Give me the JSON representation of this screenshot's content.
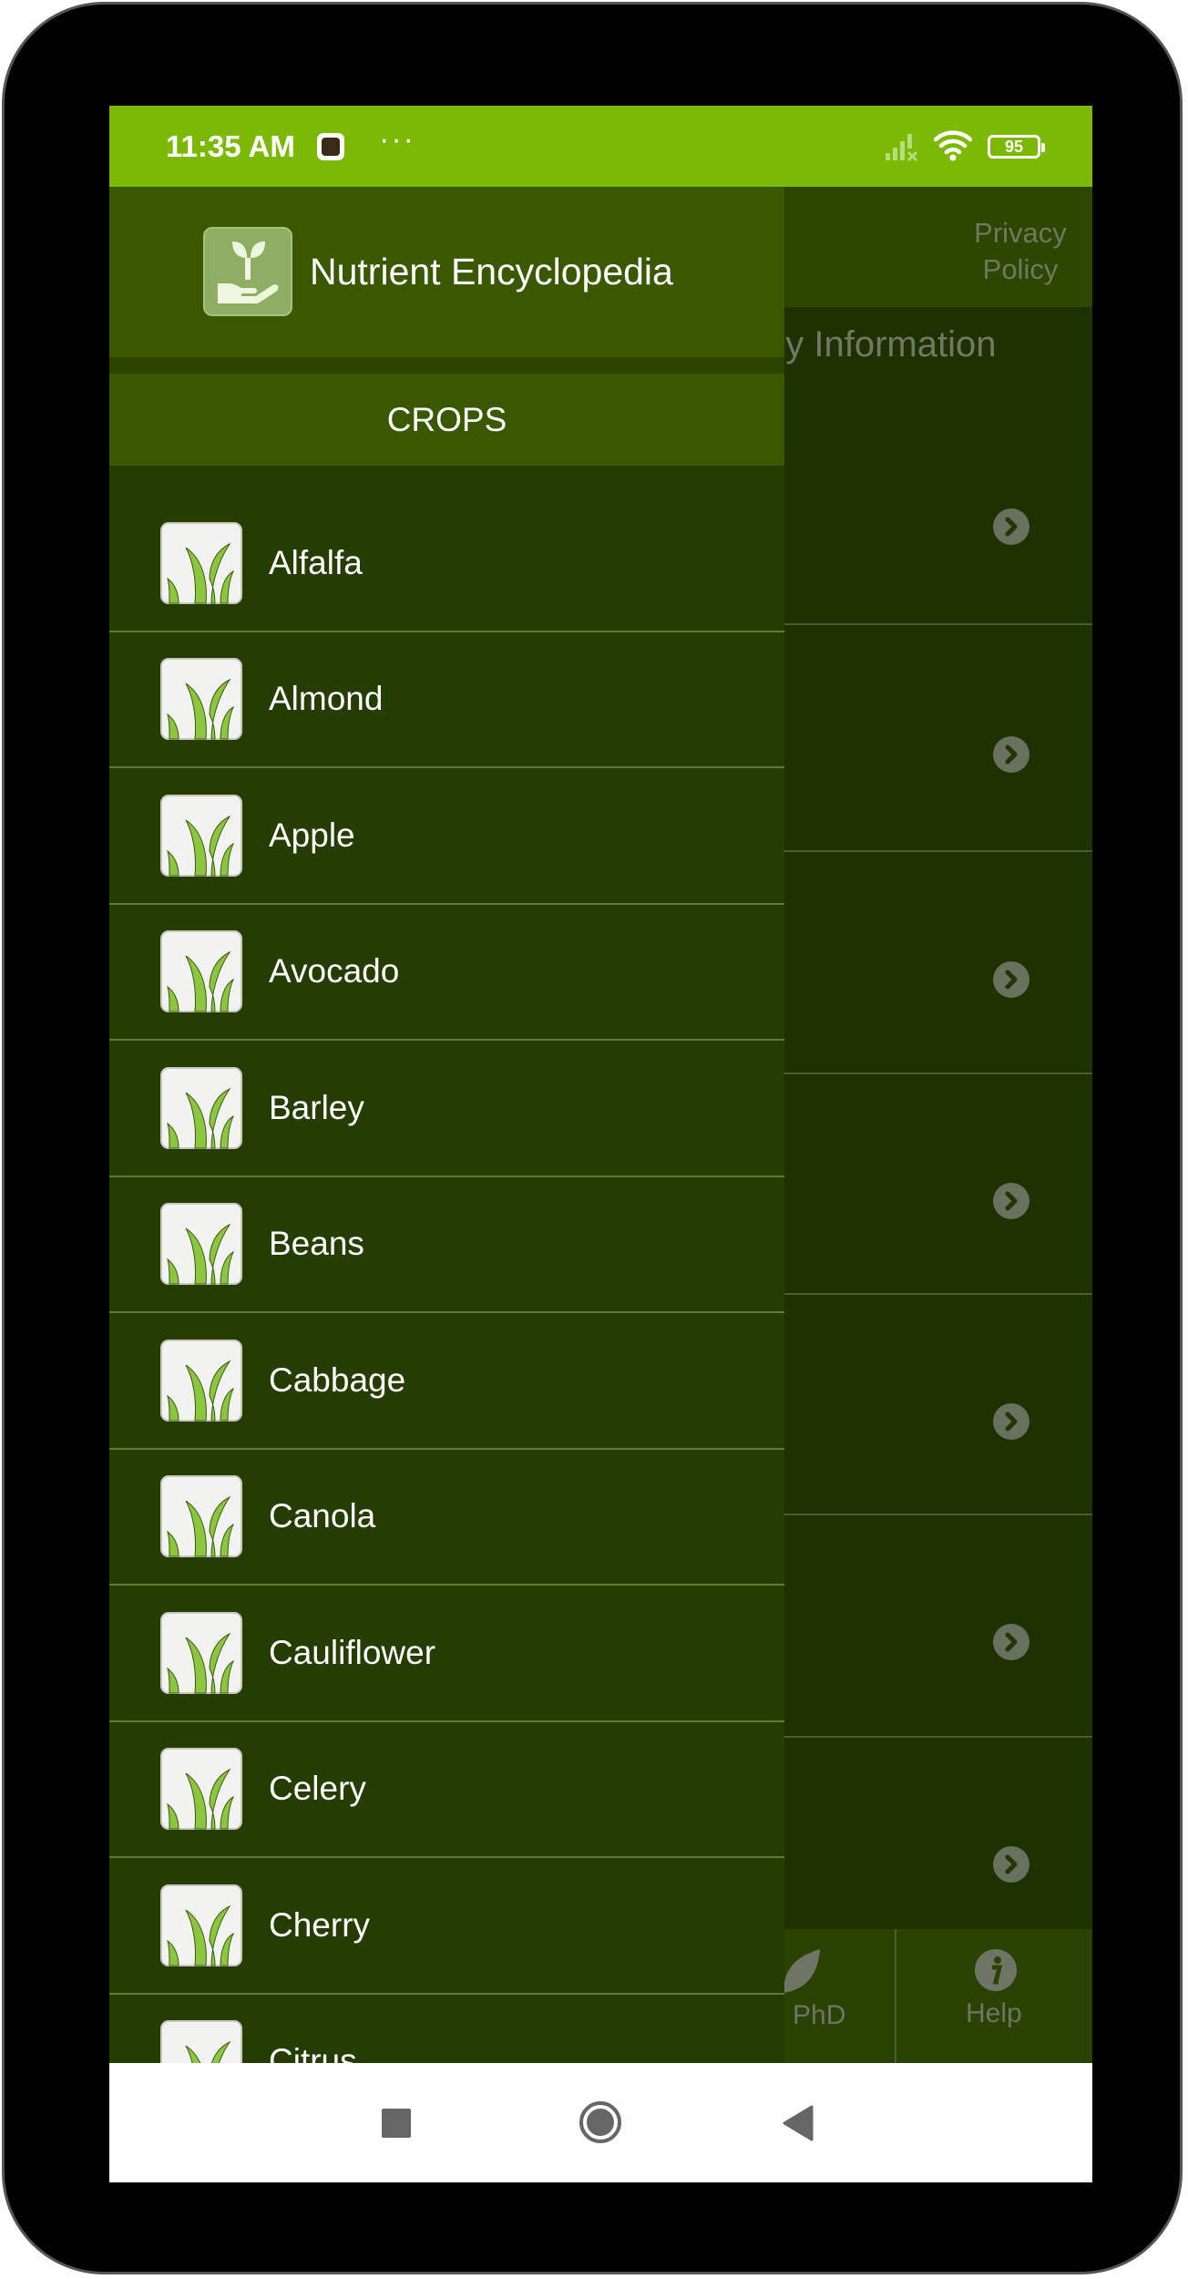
{
  "status_bar": {
    "time": "11:35 AM",
    "more": "···",
    "battery": "95"
  },
  "background": {
    "privacy_policy": "Privacy Policy",
    "section_title": "ncy Information",
    "tabs": [
      {
        "label": "PhD",
        "icon": "leaf-icon"
      },
      {
        "label": "Help",
        "icon": "info-icon"
      }
    ]
  },
  "drawer": {
    "app_title": "Nutrient Encyclopedia",
    "section": "CROPS",
    "items": [
      {
        "label": "Alfalfa"
      },
      {
        "label": "Almond"
      },
      {
        "label": "Apple"
      },
      {
        "label": "Avocado"
      },
      {
        "label": "Barley"
      },
      {
        "label": "Beans"
      },
      {
        "label": "Cabbage"
      },
      {
        "label": "Canola"
      },
      {
        "label": "Cauliflower"
      },
      {
        "label": "Celery"
      },
      {
        "label": "Cherry"
      },
      {
        "label": "Citrus"
      }
    ]
  },
  "colors": {
    "status_bar": "#7bb906",
    "drawer_header": "#3a5800",
    "drawer_bg": "#253d00",
    "divider": "#5f7f2c"
  }
}
